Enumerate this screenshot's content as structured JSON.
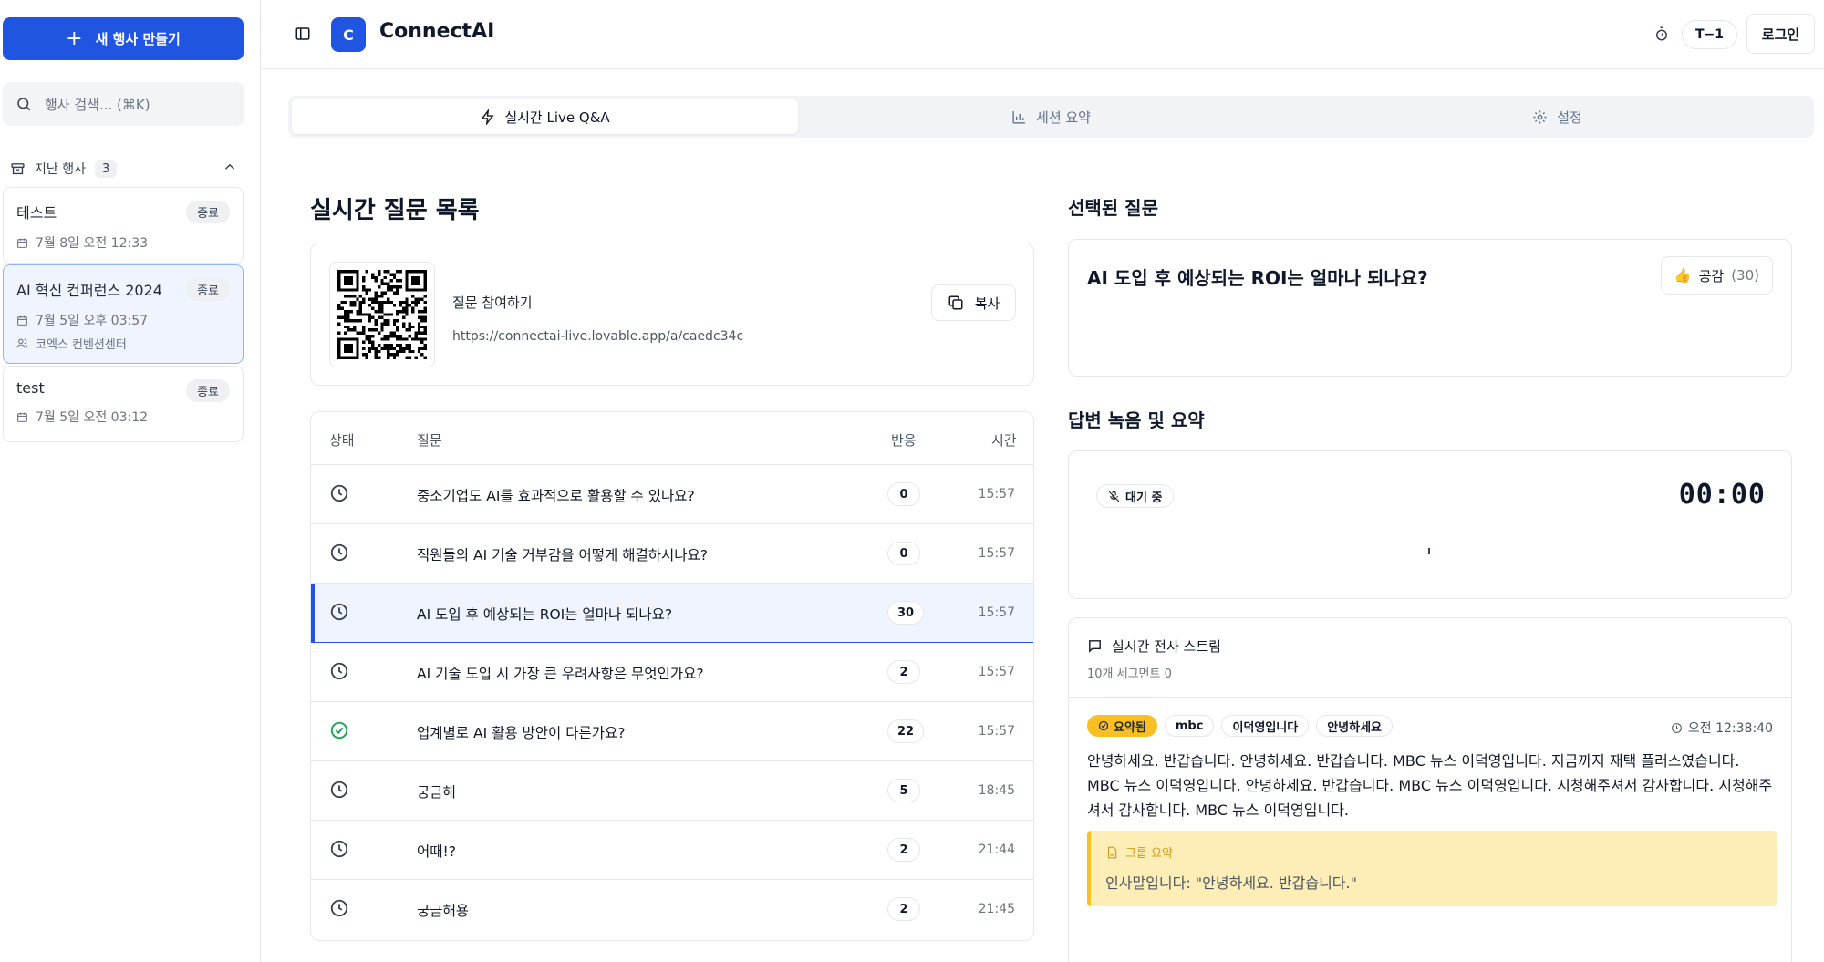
{
  "sidebar": {
    "new_event_label": "새 행사 만들기",
    "search_placeholder": "행사 검색... (⌘K)",
    "section_label": "지난 행사",
    "section_count": "3",
    "events": [
      {
        "name": "테스트",
        "status": "종료",
        "date": "7월 8일 오전 12:33",
        "location": ""
      },
      {
        "name": "AI 혁신 컨퍼런스 2024",
        "status": "종료",
        "date": "7월 5일 오후 03:57",
        "location": "코엑스 컨벤션센터"
      },
      {
        "name": "test",
        "status": "종료",
        "date": "7월 5일 오전 03:12",
        "location": ""
      }
    ]
  },
  "header": {
    "logo_letter": "C",
    "app_title": "ConnectAI",
    "timer_badge": "T−1",
    "login_label": "로그인"
  },
  "tabs": [
    {
      "label": "실시간 Live Q&A",
      "icon": "lightning-icon",
      "active": true
    },
    {
      "label": "세션 요약",
      "icon": "bar-chart-icon",
      "active": false
    },
    {
      "label": "설정",
      "icon": "gear-icon",
      "active": false
    }
  ],
  "question_list": {
    "heading": "실시간 질문 목록",
    "join_label": "질문 참여하기",
    "join_url": "https://connectai-live.lovable.app/a/caedc34c",
    "copy_label": "복사",
    "columns": {
      "status": "상태",
      "question": "질문",
      "reactions": "반응",
      "time": "시간"
    },
    "rows": [
      {
        "status": "pending",
        "question": "중소기업도 AI를 효과적으로 활용할 수 있나요?",
        "reactions": "0",
        "time": "15:57"
      },
      {
        "status": "pending",
        "question": "직원들의 AI 기술 거부감을 어떻게 해결하시나요?",
        "reactions": "0",
        "time": "15:57"
      },
      {
        "status": "pending",
        "question": "AI 도입 후 예상되는 ROI는 얼마나 되나요?",
        "reactions": "30",
        "time": "15:57",
        "selected": true
      },
      {
        "status": "pending",
        "question": "AI 기술 도입 시 가장 큰 우려사항은 무엇인가요?",
        "reactions": "2",
        "time": "15:57"
      },
      {
        "status": "answered",
        "question": "업계별로 AI 활용 방안이 다른가요?",
        "reactions": "22",
        "time": "15:57"
      },
      {
        "status": "pending",
        "question": "궁금해",
        "reactions": "5",
        "time": "18:45"
      },
      {
        "status": "pending",
        "question": "어때!?",
        "reactions": "2",
        "time": "21:44"
      },
      {
        "status": "pending",
        "question": "궁금해용",
        "reactions": "2",
        "time": "21:45"
      }
    ]
  },
  "selected": {
    "heading": "선택된 질문",
    "question": "AI 도입 후 예상되는 ROI는 얼마나 되나요?",
    "like_label": "공감",
    "like_count": "(30)"
  },
  "recording": {
    "heading": "답변 녹음 및 요약",
    "status": "대기 중",
    "time": "00:00"
  },
  "transcript": {
    "title": "실시간 전사 스트림",
    "subtitle": "10개 세그먼트 0",
    "chips": [
      "요약됨",
      "mbc",
      "이덕영입니다",
      "안녕하세요"
    ],
    "time": "오전 12:38:40",
    "text": "안녕하세요. 반갑습니다. 안녕하세요. 반갑습니다. MBC 뉴스 이덕영입니다. 지금까지 재택 플러스였습니다. MBC 뉴스 이덕영입니다. 안녕하세요. 반갑습니다. MBC 뉴스 이덕영입니다. 시청해주셔서 감사합니다. 시청해주셔서 감사합니다. MBC 뉴스 이덕영입니다.",
    "summary_title": "그룹 요약",
    "summary_text": "인사말입니다: \"안녕하세요. 반갑습니다.\""
  },
  "colors": {
    "accent": "#1f55e0",
    "summary_bg": "#fdeeb8",
    "summary_border": "#fbbf24",
    "answered": "#16a34a"
  }
}
